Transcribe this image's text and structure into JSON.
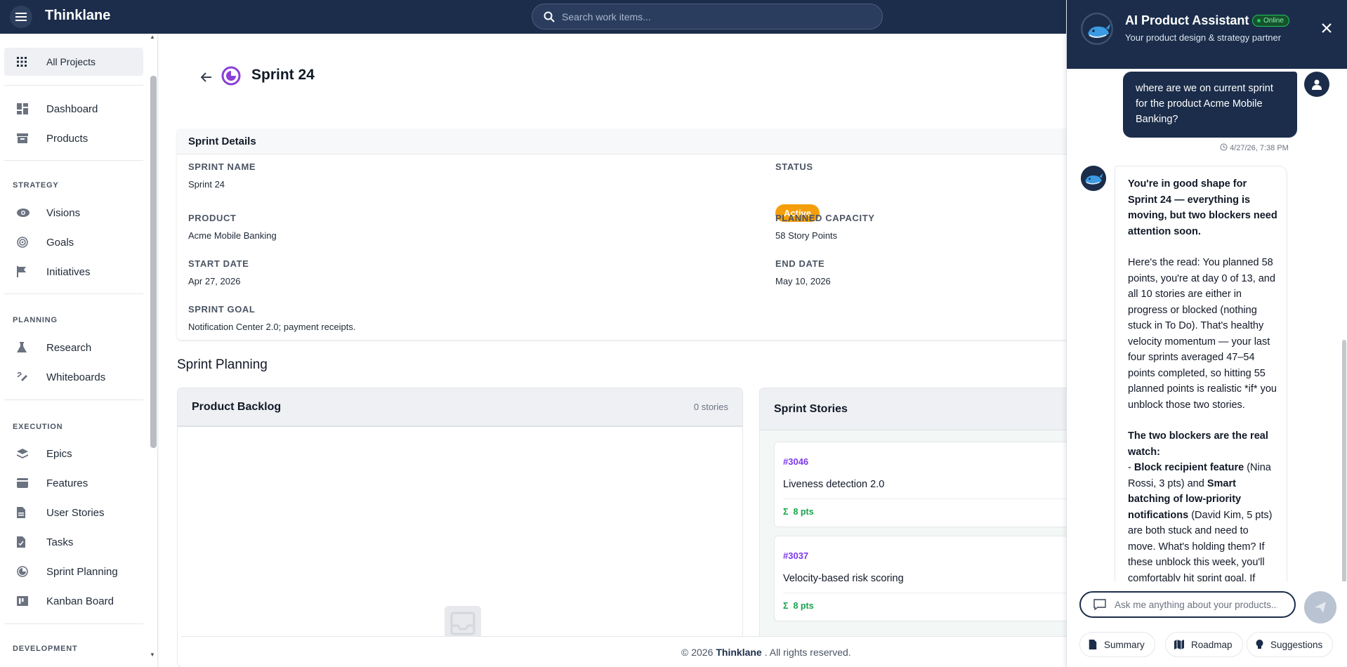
{
  "topbar": {
    "brand": "Thinklane",
    "search_placeholder": "Search work items..."
  },
  "sidebar": {
    "all_projects": "All Projects",
    "dashboard": "Dashboard",
    "products": "Products",
    "sections": {
      "strategy": "STRATEGY",
      "planning": "PLANNING",
      "execution": "EXECUTION",
      "development": "DEVELOPMENT"
    },
    "strategy_items": [
      "Visions",
      "Goals",
      "Initiatives"
    ],
    "planning_items": [
      "Research",
      "Whiteboards"
    ],
    "execution_items": [
      "Epics",
      "Features",
      "User Stories",
      "Tasks",
      "Sprint Planning",
      "Kanban Board"
    ]
  },
  "page": {
    "title": "Sprint 24"
  },
  "details": {
    "header": "Sprint Details",
    "sprint_name_label": "SPRINT NAME",
    "sprint_name": "Sprint 24",
    "status_label": "STATUS",
    "status": "Active",
    "product_label": "PRODUCT",
    "product": "Acme Mobile Banking",
    "capacity_label": "PLANNED CAPACITY",
    "capacity": "58 Story Points",
    "start_label": "START DATE",
    "start": "Apr 27, 2026",
    "end_label": "END DATE",
    "end": "May 10, 2026",
    "goal_label": "SPRINT GOAL",
    "goal": "Notification Center 2.0; payment receipts."
  },
  "planning": {
    "title": "Sprint Planning",
    "backlog_title": "Product Backlog",
    "backlog_count": "0 stories",
    "stories_title": "Sprint Stories",
    "stories": [
      {
        "id": "#3046",
        "title": "Liveness detection 2.0",
        "points": "8 pts"
      },
      {
        "id": "#3037",
        "title": "Velocity-based risk scoring",
        "points": "8 pts"
      }
    ]
  },
  "footer": {
    "prefix": "© 2026",
    "brand": "Thinklane",
    "suffix": ". All rights reserved."
  },
  "assistant": {
    "title": "AI Product Assistant",
    "status": "Online",
    "subtitle": "Your product design & strategy partner",
    "user_message": "where are we on current sprint for the product Acme Mobile Banking?",
    "timestamp": "4/27/26, 7:38 PM",
    "reply": {
      "intro": "You're in good shape for Sprint 24 — everything is moving, but two blockers need attention soon.",
      "body": "Here's the read: You planned 58 points, you're at day 0 of 13, and all 10 stories are either in progress or blocked (nothing stuck in To Do). That's healthy velocity momentum — your last four sprints averaged 47–54 points completed, so hitting 55 planned points is realistic *if* you unblock those two stories.",
      "blockers_heading": "The two blockers are the real watch:",
      "blocker_prefix": "- ",
      "blocker1": "Block recipient feature",
      "blocker1_meta": " (Nina Rossi, 3 pts) and ",
      "blocker2": "Smart batching of low-priority notifications",
      "blocker2_meta": " (David Kim, 5 pts) are both stuck and need to move. What's holding them? If these unblock this week, you'll comfortably hit sprint goal. If"
    },
    "input_placeholder": "Ask me anything about your products...",
    "chips": [
      "Summary",
      "Roadmap",
      "Suggestions"
    ]
  }
}
